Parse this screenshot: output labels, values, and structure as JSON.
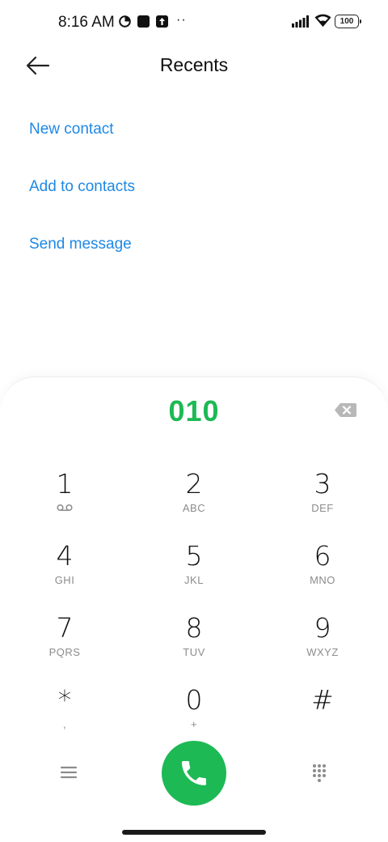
{
  "status_bar": {
    "time": "8:16 AM",
    "dots": "··",
    "battery": "100"
  },
  "header": {
    "title": "Recents"
  },
  "actions": [
    {
      "label": "New contact"
    },
    {
      "label": "Add to contacts"
    },
    {
      "label": "Send message"
    }
  ],
  "dialer": {
    "number": "010",
    "keys": [
      {
        "digit": "1",
        "letters": ""
      },
      {
        "digit": "2",
        "letters": "ABC"
      },
      {
        "digit": "3",
        "letters": "DEF"
      },
      {
        "digit": "4",
        "letters": "GHI"
      },
      {
        "digit": "5",
        "letters": "JKL"
      },
      {
        "digit": "6",
        "letters": "MNO"
      },
      {
        "digit": "7",
        "letters": "PQRS"
      },
      {
        "digit": "8",
        "letters": "TUV"
      },
      {
        "digit": "9",
        "letters": "WXYZ"
      },
      {
        "digit": "*",
        "letters": ","
      },
      {
        "digit": "0",
        "letters": "+"
      },
      {
        "digit": "#",
        "letters": ""
      }
    ]
  },
  "icons": {
    "back": "arrow-left-icon",
    "backspace": "backspace-icon",
    "voicemail": "voicemail-icon",
    "menu": "menu-icon",
    "keypad": "keypad-icon",
    "call": "phone-icon"
  },
  "colors": {
    "accent": "#1e88e5",
    "call": "#1db954",
    "number": "#1db954"
  }
}
